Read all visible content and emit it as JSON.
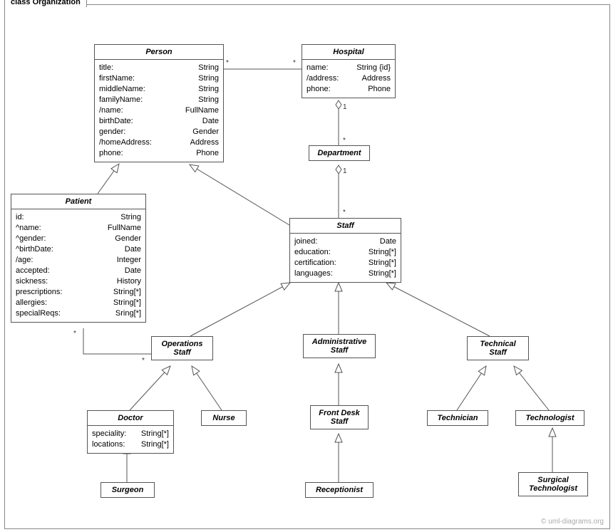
{
  "frame_title": "class Organization",
  "classes": {
    "person": {
      "name": "Person",
      "attrs": [
        {
          "n": "title:",
          "t": "String"
        },
        {
          "n": "firstName:",
          "t": "String"
        },
        {
          "n": "middleName:",
          "t": "String"
        },
        {
          "n": "familyName:",
          "t": "String"
        },
        {
          "n": "/name:",
          "t": "FullName"
        },
        {
          "n": "birthDate:",
          "t": "Date"
        },
        {
          "n": "gender:",
          "t": "Gender"
        },
        {
          "n": "/homeAddress:",
          "t": "Address"
        },
        {
          "n": "phone:",
          "t": "Phone"
        }
      ]
    },
    "hospital": {
      "name": "Hospital",
      "attrs": [
        {
          "n": "name:",
          "t": "String {id}"
        },
        {
          "n": "/address:",
          "t": "Address"
        },
        {
          "n": "phone:",
          "t": "Phone"
        }
      ]
    },
    "department": {
      "name": "Department"
    },
    "patient": {
      "name": "Patient",
      "attrs": [
        {
          "n": "id:",
          "t": "String"
        },
        {
          "n": "^name:",
          "t": "FullName"
        },
        {
          "n": "^gender:",
          "t": "Gender"
        },
        {
          "n": "^birthDate:",
          "t": "Date"
        },
        {
          "n": "/age:",
          "t": "Integer"
        },
        {
          "n": "accepted:",
          "t": "Date"
        },
        {
          "n": "sickness:",
          "t": "History"
        },
        {
          "n": "prescriptions:",
          "t": "String[*]"
        },
        {
          "n": "allergies:",
          "t": "String[*]"
        },
        {
          "n": "specialReqs:",
          "t": "Sring[*]"
        }
      ]
    },
    "staff": {
      "name": "Staff",
      "attrs": [
        {
          "n": "joined:",
          "t": "Date"
        },
        {
          "n": "education:",
          "t": "String[*]"
        },
        {
          "n": "certification:",
          "t": "String[*]"
        },
        {
          "n": "languages:",
          "t": "String[*]"
        }
      ]
    },
    "ops_staff": {
      "name": "Operations",
      "sub": "Staff"
    },
    "admin_staff": {
      "name": "Administrative",
      "sub": "Staff"
    },
    "tech_staff": {
      "name": "Technical",
      "sub": "Staff"
    },
    "doctor": {
      "name": "Doctor",
      "attrs": [
        {
          "n": "speciality:",
          "t": "String[*]"
        },
        {
          "n": "locations:",
          "t": "String[*]"
        }
      ]
    },
    "nurse": {
      "name": "Nurse"
    },
    "front_desk": {
      "name": "Front Desk",
      "sub": "Staff"
    },
    "technician": {
      "name": "Technician"
    },
    "technologist": {
      "name": "Technologist"
    },
    "surgeon": {
      "name": "Surgeon"
    },
    "receptionist": {
      "name": "Receptionist"
    },
    "surg_tech": {
      "name": "Surgical",
      "sub": "Technologist"
    }
  },
  "mults": {
    "ph_star1": "*",
    "ph_star2": "*",
    "hd_1": "1",
    "hd_star": "*",
    "ds_1": "1",
    "ds_star": "*",
    "po_star1": "*",
    "po_star2": "*"
  },
  "watermark": "© uml-diagrams.org"
}
